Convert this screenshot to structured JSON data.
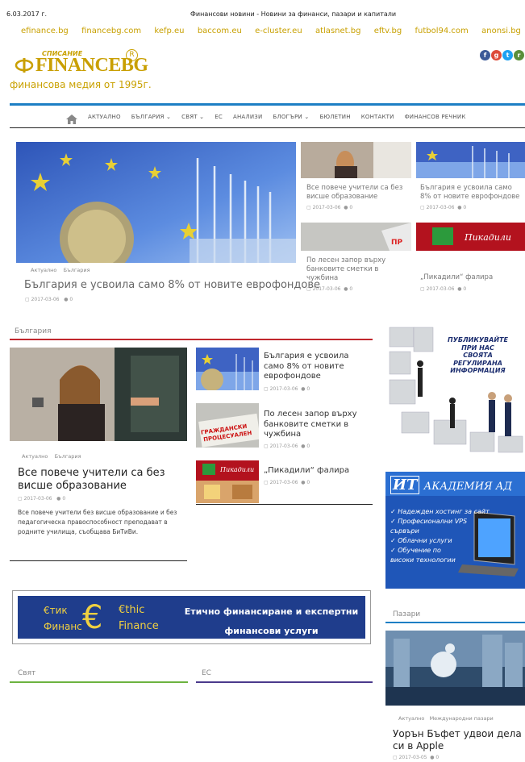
{
  "top": {
    "date": "6.03.2017 г.",
    "title": "Финансови новини - Новини за финанси, пазари и капитали",
    "links": [
      "efinance.bg",
      "financebg.com",
      "kefp.eu",
      "baccom.eu",
      "e-cluster.eu",
      "atlasnet.bg",
      "eftv.bg",
      "futbol94.com",
      "anonsi.bg"
    ]
  },
  "logo": {
    "small": "СПИСАНИЕ",
    "name": "FINANCEBG",
    "reg": "R",
    "sub": "финансова медия от 1995г."
  },
  "nav": [
    "АКТУАЛНО",
    "БЪЛГАРИЯ ⌄",
    "СВЯТ ⌄",
    "ЕС",
    "АНАЛИЗИ",
    "БЛОГЪРИ ⌄",
    "БЮЛЕТИН",
    "КОНТАКТИ",
    "ФИНАНСОВ РЕЧНИК"
  ],
  "hero": {
    "cat1": "Актуално",
    "cat2": "България",
    "title": "България е усвоила само 8% от новите еврофондове",
    "date": "2017-03-06",
    "comments": "0"
  },
  "grid": [
    {
      "title": "Все повече учители са без висше образование",
      "date": "2017-03-06",
      "comments": "0"
    },
    {
      "title": "България е усвоила само 8% от новите еврофондове",
      "date": "2017-03-06",
      "comments": "0"
    },
    {
      "title": "По лесен запор върху банковите сметки в чужбина",
      "date": "2017-03-06",
      "comments": "0"
    },
    {
      "title": "„Пикадили“ фалира",
      "date": "2017-03-06",
      "comments": "0"
    }
  ],
  "bulgaria": {
    "heading": "България",
    "main": {
      "cat1": "Актуално",
      "cat2": "България",
      "title": "Все повече учители са без висше образование",
      "date": "2017-03-06",
      "comments": "0",
      "excerpt": "Все повече учители без висше образование и без педагогическа правоспособност преподават в родните училища, съобщава БиТиВи."
    },
    "list": [
      {
        "title": "България е усвоила само 8% от новите еврофондове",
        "date": "2017-03-06",
        "comments": "0"
      },
      {
        "title": "По лесен запор върху банковите сметки в чужбина",
        "date": "2017-03-06",
        "comments": "0"
      },
      {
        "title": "„Пикадили“ фалира",
        "date": "2017-03-06",
        "comments": "0"
      }
    ]
  },
  "ad_publish": [
    "ПУБЛИКУВАЙТЕ",
    "ПРИ НАС",
    "СВОЯТА",
    "РЕГУЛИРАНА",
    "ИНФОРМАЦИЯ"
  ],
  "ad_it": {
    "logo1": "ИТ",
    "logo2": "АКАДЕМИЯ АД",
    "items": [
      "✓ Надежден хостинг за сайт",
      "✓ Професионални VPS",
      "сървъри",
      "✓ Облачни услуги",
      "✓ Обучение по",
      "високи технологии"
    ]
  },
  "banner": {
    "left1": "€тик",
    "left2": "Финанс",
    "mid1": "€thic",
    "mid2": "Finance",
    "right1": "Етично финансиране и експертни",
    "right2": "финансови услуги"
  },
  "svyat": "Свят",
  "es": "ЕС",
  "markets": {
    "heading": "Пазари",
    "cat1": "Актуално",
    "cat2": "Международни пазари",
    "title": "Уорън Бъфет удвои дела си в Apple",
    "date": "2017-03-05",
    "comments": "0"
  }
}
